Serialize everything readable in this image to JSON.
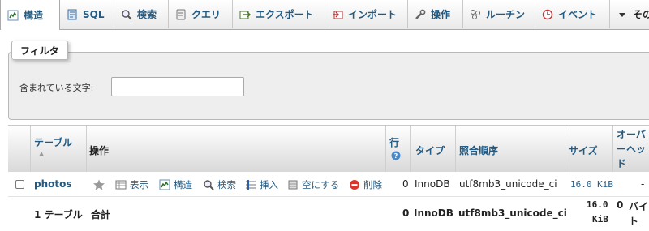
{
  "tabs": [
    {
      "label": "構造",
      "icon": "structure-icon",
      "active": true
    },
    {
      "label": "SQL",
      "icon": "sql-icon"
    },
    {
      "label": "検索",
      "icon": "search-icon"
    },
    {
      "label": "クエリ",
      "icon": "query-icon"
    },
    {
      "label": "エクスポート",
      "icon": "export-icon"
    },
    {
      "label": "インポート",
      "icon": "import-icon"
    },
    {
      "label": "操作",
      "icon": "wrench-icon"
    },
    {
      "label": "ルーチン",
      "icon": "routines-icon"
    },
    {
      "label": "イベント",
      "icon": "clock-icon"
    },
    {
      "label": "その",
      "icon": "dropdown-arrow-icon"
    }
  ],
  "filter": {
    "legend": "フィルタ",
    "label": "含まれている文字:",
    "value": ""
  },
  "table": {
    "headers": {
      "table": "テーブル",
      "actions": "操作",
      "rows": "行",
      "type": "タイプ",
      "collation": "照合順序",
      "size": "サイズ",
      "overhead": "オーバーヘッド"
    },
    "row": {
      "name": "photos",
      "actions": [
        {
          "label": "表示",
          "icon": "browse-icon"
        },
        {
          "label": "構造",
          "icon": "structure-icon"
        },
        {
          "label": "検索",
          "icon": "search-icon"
        },
        {
          "label": "挿入",
          "icon": "insert-icon"
        },
        {
          "label": "空にする",
          "icon": "empty-icon"
        },
        {
          "label": "削除",
          "icon": "drop-icon"
        }
      ],
      "rows": "0",
      "type": "InnoDB",
      "collation": "utf8mb3_unicode_ci",
      "size": "16.0 KiB",
      "overhead": "-"
    },
    "summary": {
      "count": "1 テーブル",
      "label": "合計",
      "rows": "0",
      "type": "InnoDB",
      "collation": "utf8mb3_unicode_ci",
      "size_value": "16.0",
      "size_unit": "KiB",
      "overhead_value": "0",
      "overhead_unit": "バイト"
    }
  }
}
